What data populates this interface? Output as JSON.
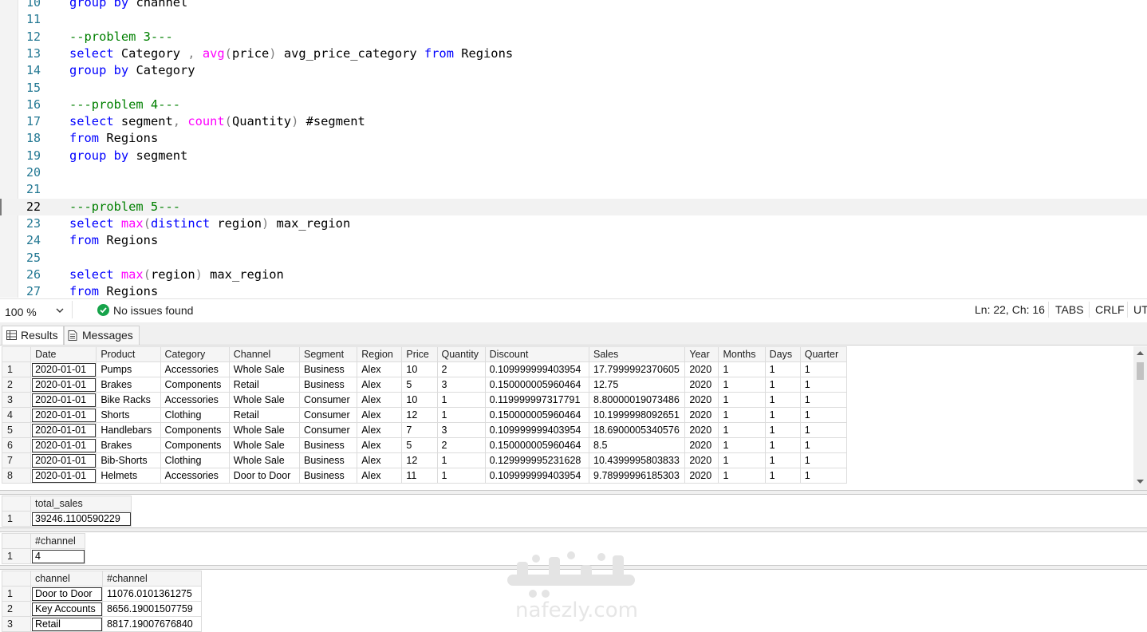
{
  "editor": {
    "lines": [
      {
        "n": "10",
        "segs": [
          {
            "t": "group",
            "c": "kw"
          },
          {
            "t": " "
          },
          {
            "t": "by",
            "c": "kw"
          },
          {
            "t": " channel"
          }
        ]
      },
      {
        "n": "11",
        "segs": []
      },
      {
        "n": "12",
        "segs": [
          {
            "t": "--problem 3---",
            "c": "cm"
          }
        ]
      },
      {
        "n": "13",
        "segs": [
          {
            "t": "select",
            "c": "kw"
          },
          {
            "t": " Category "
          },
          {
            "t": ",",
            "c": "op"
          },
          {
            "t": " "
          },
          {
            "t": "avg",
            "c": "fn"
          },
          {
            "t": "(",
            "c": "op"
          },
          {
            "t": "price"
          },
          {
            "t": ")",
            "c": "op"
          },
          {
            "t": " avg_price_category "
          },
          {
            "t": "from",
            "c": "kw"
          },
          {
            "t": " Regions"
          }
        ]
      },
      {
        "n": "14",
        "segs": [
          {
            "t": "group",
            "c": "kw"
          },
          {
            "t": " "
          },
          {
            "t": "by",
            "c": "kw"
          },
          {
            "t": " Category"
          }
        ]
      },
      {
        "n": "15",
        "segs": []
      },
      {
        "n": "16",
        "segs": [
          {
            "t": "---problem 4---",
            "c": "cm"
          }
        ]
      },
      {
        "n": "17",
        "segs": [
          {
            "t": "select",
            "c": "kw"
          },
          {
            "t": " segment"
          },
          {
            "t": ",",
            "c": "op"
          },
          {
            "t": " "
          },
          {
            "t": "count",
            "c": "fn"
          },
          {
            "t": "(",
            "c": "op"
          },
          {
            "t": "Quantity"
          },
          {
            "t": ")",
            "c": "op"
          },
          {
            "t": " #segment"
          }
        ]
      },
      {
        "n": "18",
        "segs": [
          {
            "t": "from",
            "c": "kw"
          },
          {
            "t": " Regions"
          }
        ]
      },
      {
        "n": "19",
        "segs": [
          {
            "t": "group",
            "c": "kw"
          },
          {
            "t": " "
          },
          {
            "t": "by",
            "c": "kw"
          },
          {
            "t": " segment"
          }
        ]
      },
      {
        "n": "20",
        "segs": []
      },
      {
        "n": "21",
        "segs": []
      },
      {
        "n": "22",
        "current": true,
        "segs": [
          {
            "t": "---problem 5---",
            "c": "cm"
          }
        ]
      },
      {
        "n": "23",
        "segs": [
          {
            "t": "select",
            "c": "kw"
          },
          {
            "t": " "
          },
          {
            "t": "max",
            "c": "fn"
          },
          {
            "t": "(",
            "c": "op"
          },
          {
            "t": "distinct",
            "c": "kw"
          },
          {
            "t": " region"
          },
          {
            "t": ")",
            "c": "op"
          },
          {
            "t": " max_region"
          }
        ]
      },
      {
        "n": "24",
        "segs": [
          {
            "t": "from",
            "c": "kw"
          },
          {
            "t": " Regions"
          }
        ]
      },
      {
        "n": "25",
        "segs": []
      },
      {
        "n": "26",
        "segs": [
          {
            "t": "select",
            "c": "kw"
          },
          {
            "t": " "
          },
          {
            "t": "max",
            "c": "fn"
          },
          {
            "t": "(",
            "c": "op"
          },
          {
            "t": "region"
          },
          {
            "t": ")",
            "c": "op"
          },
          {
            "t": " max_region"
          }
        ]
      },
      {
        "n": "27",
        "segs": [
          {
            "t": "from",
            "c": "kw"
          },
          {
            "t": " Regions"
          }
        ]
      }
    ]
  },
  "status": {
    "zoom": "100 %",
    "issues": "No issues found",
    "position": "Ln: 22, Ch: 16",
    "indent": "TABS",
    "eol": "CRLF",
    "encoding": "UT"
  },
  "tabs": {
    "results": "Results",
    "messages": "Messages"
  },
  "grid1": {
    "columns": [
      "Date",
      "Product",
      "Category",
      "Channel",
      "Segment",
      "Region",
      "Price",
      "Quantity",
      "Discount",
      "Sales",
      "Year",
      "Months",
      "Days",
      "Quarter"
    ],
    "rows": [
      [
        "1",
        "2020-01-01",
        "Pumps",
        "Accessories",
        "Whole Sale",
        "Business",
        "Alex",
        "10",
        "2",
        "0.109999999403954",
        "17.7999992370605",
        "2020",
        "1",
        "1",
        "1"
      ],
      [
        "2",
        "2020-01-01",
        "Brakes",
        "Components",
        "Retail",
        "Business",
        "Alex",
        "5",
        "3",
        "0.150000005960464",
        "12.75",
        "2020",
        "1",
        "1",
        "1"
      ],
      [
        "3",
        "2020-01-01",
        "Bike Racks",
        "Accessories",
        "Whole Sale",
        "Consumer",
        "Alex",
        "10",
        "1",
        "0.119999997317791",
        "8.80000019073486",
        "2020",
        "1",
        "1",
        "1"
      ],
      [
        "4",
        "2020-01-01",
        "Shorts",
        "Clothing",
        "Retail",
        "Consumer",
        "Alex",
        "12",
        "1",
        "0.150000005960464",
        "10.1999998092651",
        "2020",
        "1",
        "1",
        "1"
      ],
      [
        "5",
        "2020-01-01",
        "Handlebars",
        "Components",
        "Whole Sale",
        "Consumer",
        "Alex",
        "7",
        "3",
        "0.109999999403954",
        "18.6900005340576",
        "2020",
        "1",
        "1",
        "1"
      ],
      [
        "6",
        "2020-01-01",
        "Brakes",
        "Components",
        "Whole Sale",
        "Business",
        "Alex",
        "5",
        "2",
        "0.150000005960464",
        "8.5",
        "2020",
        "1",
        "1",
        "1"
      ],
      [
        "7",
        "2020-01-01",
        "Bib-Shorts",
        "Clothing",
        "Whole Sale",
        "Business",
        "Alex",
        "12",
        "1",
        "0.129999995231628",
        "10.4399995803833",
        "2020",
        "1",
        "1",
        "1"
      ],
      [
        "8",
        "2020-01-01",
        "Helmets",
        "Accessories",
        "Door to Door",
        "Business",
        "Alex",
        "11",
        "1",
        "0.109999999403954",
        "9.78999996185303",
        "2020",
        "1",
        "1",
        "1"
      ]
    ]
  },
  "grid2": {
    "columns": [
      "total_sales"
    ],
    "rows": [
      [
        "1",
        "39246.1100590229"
      ]
    ]
  },
  "grid3": {
    "columns": [
      "#channel"
    ],
    "rows": [
      [
        "1",
        "4"
      ]
    ]
  },
  "grid4": {
    "columns": [
      "channel",
      "#channel"
    ],
    "rows": [
      [
        "1",
        "Door to Door",
        "11076.0101361275"
      ],
      [
        "2",
        "Key Accounts",
        "8656.19001507759"
      ],
      [
        "3",
        "Retail",
        "8817.19007676840"
      ]
    ]
  },
  "watermark": {
    "text": "nafezly.com"
  },
  "colors": {
    "keyword": "#0000ff",
    "function": "#ff00ff",
    "comment": "#008000",
    "line_number": "#237893",
    "ok": "#16a34a"
  }
}
